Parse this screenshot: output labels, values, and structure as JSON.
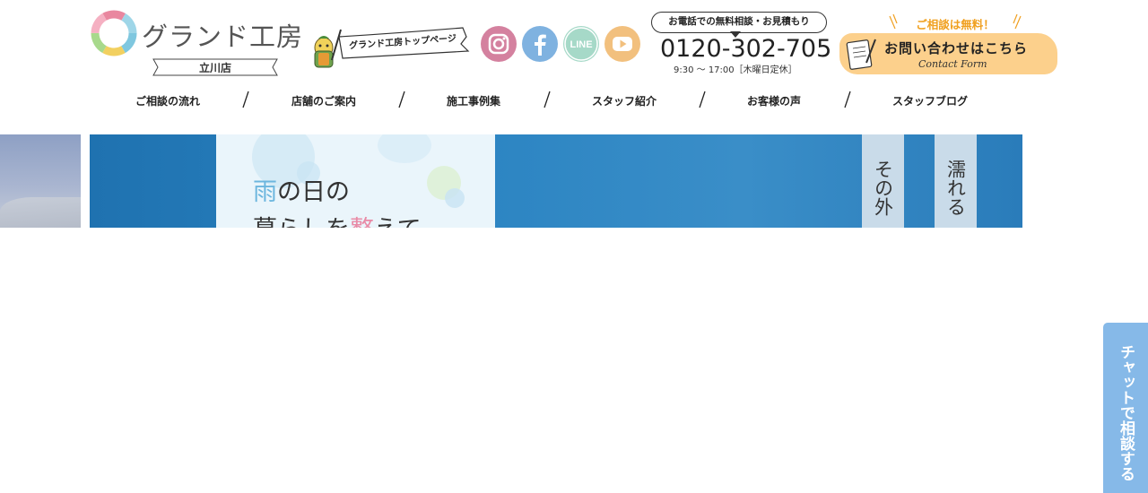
{
  "brand": {
    "name": "グランド工房",
    "branch": "立川店"
  },
  "header": {
    "top_page_link": "グランド工房トップページ",
    "sns": [
      {
        "icon": "instagram-icon",
        "color": "#d4819f"
      },
      {
        "icon": "facebook-icon",
        "color": "#7fb2e0"
      },
      {
        "icon": "line-icon",
        "color": "#a6d9c8"
      },
      {
        "icon": "youtube-icon",
        "color": "#f2c07e"
      }
    ],
    "phone": {
      "caption": "お電話での無料相談・お見積もり",
      "number": "0120-302-705",
      "hours": "9:30 〜 17:00［木曜日定休］"
    },
    "contact": {
      "free_label": "ご相談は無料！",
      "button_label": "お問い合わせはこちら",
      "button_sub": "Contact Form",
      "accent": "#fcd08c"
    }
  },
  "nav": {
    "items": [
      {
        "label": "ご相談の流れ"
      },
      {
        "label": "店舗のご案内"
      },
      {
        "label": "施工事例集"
      },
      {
        "label": "スタッフ紹介"
      },
      {
        "label": "お客様の声"
      },
      {
        "label": "スタッフブログ"
      }
    ]
  },
  "hero": {
    "heading_line1_accent": "雨",
    "heading_line1_rest": "の日の",
    "heading_line2_part1": "暮らしを",
    "heading_line2_accent": "整",
    "heading_line2_part2": "えて",
    "vertical_text_1": "その外",
    "vertical_text_2": "濡れる"
  },
  "chat": {
    "label": "チャットで相談する"
  }
}
